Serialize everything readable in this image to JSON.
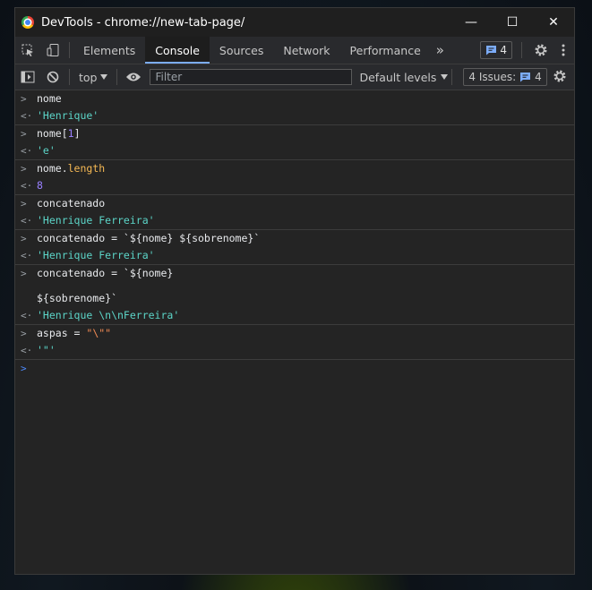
{
  "window": {
    "title": "DevTools - chrome://new-tab-page/"
  },
  "window_controls": {
    "minimize": "—",
    "maximize": "☐",
    "close": "✕"
  },
  "tabs": [
    "Elements",
    "Console",
    "Sources",
    "Network",
    "Performance"
  ],
  "active_tab": "Console",
  "more_tabs": "»",
  "messages_count": "4",
  "toolbar": {
    "context": "top",
    "filter_placeholder": "Filter",
    "levels": "Default levels",
    "issues_label": "4 Issues:",
    "issues_count": "4"
  },
  "console": [
    {
      "input": "nome",
      "output": "'Henrique'"
    },
    {
      "input_a": "nome[",
      "input_num": "1",
      "input_b": "]",
      "output": "'e'"
    },
    {
      "input_a": "nome.",
      "input_prop": "length",
      "output": "8"
    },
    {
      "input": "concatenado",
      "output": "'Henrique Ferreira'"
    },
    {
      "input": "concatenado = `${nome} ${sobrenome}`",
      "output": "'Henrique Ferreira'"
    },
    {
      "input_line1": "concatenado = `${nome}",
      "input_line2": "${sobrenome}`",
      "output": "'Henrique \\n\\nFerreira'"
    },
    {
      "input_a": "aspas = ",
      "input_str": "\"\\\"\"",
      "output": "'\"'"
    }
  ],
  "colors": {
    "accent": "#7cacf8",
    "string_result": "#5cd5c8",
    "number_result": "#9980ff",
    "property": "#f5b854",
    "string_literal": "#f28b54",
    "panel_bg": "#242424"
  }
}
